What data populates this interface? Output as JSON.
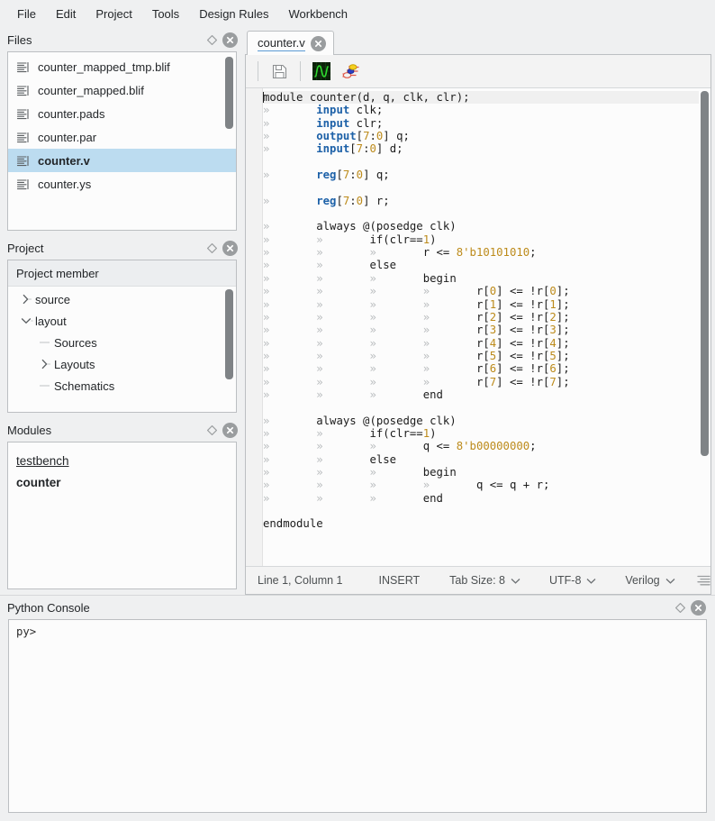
{
  "menubar": {
    "items": [
      {
        "label": "File"
      },
      {
        "label": "Edit"
      },
      {
        "label": "Project"
      },
      {
        "label": "Tools"
      },
      {
        "label": "Design Rules"
      },
      {
        "label": "Workbench"
      }
    ]
  },
  "files_panel": {
    "title": "Files",
    "float_icon": "diamond-icon",
    "close_icon": "close-icon",
    "items": [
      {
        "label": "counter_mapped_tmp.blif",
        "icon": "document-icon",
        "selected": false
      },
      {
        "label": "counter_mapped.blif",
        "icon": "document-icon",
        "selected": false
      },
      {
        "label": "counter.pads",
        "icon": "document-icon",
        "selected": false
      },
      {
        "label": "counter.par",
        "icon": "document-icon",
        "selected": false
      },
      {
        "label": "counter.v",
        "icon": "document-icon",
        "selected": true
      },
      {
        "label": "counter.ys",
        "icon": "document-icon",
        "selected": false
      }
    ]
  },
  "project_panel": {
    "title": "Project",
    "column_header": "Project member",
    "items": [
      {
        "label": "source",
        "depth": 0,
        "state": "collapsed"
      },
      {
        "label": "layout",
        "depth": 0,
        "state": "expanded"
      },
      {
        "label": "Sources",
        "depth": 1,
        "state": "leaf"
      },
      {
        "label": "Layouts",
        "depth": 1,
        "state": "collapsed"
      },
      {
        "label": "Schematics",
        "depth": 1,
        "state": "leaf"
      }
    ]
  },
  "modules_panel": {
    "title": "Modules",
    "items": [
      {
        "label": "testbench",
        "style": "underline"
      },
      {
        "label": "counter",
        "style": "bold"
      }
    ]
  },
  "editor": {
    "tab": {
      "label": "counter.v",
      "close_icon": "close-icon"
    },
    "toolbar": [
      {
        "name": "save-button",
        "icon": "floppy-disk-icon"
      },
      {
        "name": "waveform-button",
        "icon": "waveform-icon"
      },
      {
        "name": "schematic-button",
        "icon": "logic-gate-icon"
      }
    ],
    "code_lines": [
      {
        "fold": "open",
        "current": true,
        "caret": true,
        "tabs": 0,
        "tokens": [
          {
            "t": "module counter(d, q, clk, clr);",
            "c": "plain"
          }
        ]
      },
      {
        "tabs": 1,
        "tokens": [
          {
            "t": "input",
            "c": "kw"
          },
          {
            "t": " clk;",
            "c": "plain"
          }
        ]
      },
      {
        "tabs": 1,
        "tokens": [
          {
            "t": "input",
            "c": "kw"
          },
          {
            "t": " clr;",
            "c": "plain"
          }
        ]
      },
      {
        "tabs": 1,
        "tokens": [
          {
            "t": "output",
            "c": "kw"
          },
          {
            "t": "[",
            "c": "plain"
          },
          {
            "t": "7",
            "c": "num"
          },
          {
            "t": ":",
            "c": "plain"
          },
          {
            "t": "0",
            "c": "num"
          },
          {
            "t": "] q;",
            "c": "plain"
          }
        ]
      },
      {
        "tabs": 1,
        "tokens": [
          {
            "t": "input",
            "c": "kw"
          },
          {
            "t": "[",
            "c": "plain"
          },
          {
            "t": "7",
            "c": "num"
          },
          {
            "t": ":",
            "c": "plain"
          },
          {
            "t": "0",
            "c": "num"
          },
          {
            "t": "] d;",
            "c": "plain"
          }
        ]
      },
      {
        "tabs": 0,
        "tokens": []
      },
      {
        "tabs": 1,
        "tokens": [
          {
            "t": "reg",
            "c": "kw"
          },
          {
            "t": "[",
            "c": "plain"
          },
          {
            "t": "7",
            "c": "num"
          },
          {
            "t": ":",
            "c": "plain"
          },
          {
            "t": "0",
            "c": "num"
          },
          {
            "t": "] q;",
            "c": "plain"
          }
        ]
      },
      {
        "tabs": 0,
        "tokens": []
      },
      {
        "tabs": 1,
        "tokens": [
          {
            "t": "reg",
            "c": "kw"
          },
          {
            "t": "[",
            "c": "plain"
          },
          {
            "t": "7",
            "c": "num"
          },
          {
            "t": ":",
            "c": "plain"
          },
          {
            "t": "0",
            "c": "num"
          },
          {
            "t": "] r;",
            "c": "plain"
          }
        ]
      },
      {
        "tabs": 0,
        "tokens": []
      },
      {
        "tabs": 1,
        "tokens": [
          {
            "t": "always @(posedge clk)",
            "c": "plain"
          }
        ]
      },
      {
        "tabs": 2,
        "tokens": [
          {
            "t": "if(clr==",
            "c": "plain"
          },
          {
            "t": "1",
            "c": "num"
          },
          {
            "t": ")",
            "c": "plain"
          }
        ]
      },
      {
        "tabs": 3,
        "tokens": [
          {
            "t": "r <= ",
            "c": "plain"
          },
          {
            "t": "8'b10101010",
            "c": "num"
          },
          {
            "t": ";",
            "c": "plain"
          }
        ]
      },
      {
        "tabs": 2,
        "tokens": [
          {
            "t": "else",
            "c": "plain"
          }
        ]
      },
      {
        "fold": "open",
        "tabs": 3,
        "tokens": [
          {
            "t": "begin",
            "c": "plain"
          }
        ]
      },
      {
        "tabs": 4,
        "tokens": [
          {
            "t": "r[",
            "c": "plain"
          },
          {
            "t": "0",
            "c": "num"
          },
          {
            "t": "] <= !r[",
            "c": "plain"
          },
          {
            "t": "0",
            "c": "num"
          },
          {
            "t": "];",
            "c": "plain"
          }
        ]
      },
      {
        "tabs": 4,
        "tokens": [
          {
            "t": "r[",
            "c": "plain"
          },
          {
            "t": "1",
            "c": "num"
          },
          {
            "t": "] <= !r[",
            "c": "plain"
          },
          {
            "t": "1",
            "c": "num"
          },
          {
            "t": "];",
            "c": "plain"
          }
        ]
      },
      {
        "tabs": 4,
        "tokens": [
          {
            "t": "r[",
            "c": "plain"
          },
          {
            "t": "2",
            "c": "num"
          },
          {
            "t": "] <= !r[",
            "c": "plain"
          },
          {
            "t": "2",
            "c": "num"
          },
          {
            "t": "];",
            "c": "plain"
          }
        ]
      },
      {
        "tabs": 4,
        "tokens": [
          {
            "t": "r[",
            "c": "plain"
          },
          {
            "t": "3",
            "c": "num"
          },
          {
            "t": "] <= !r[",
            "c": "plain"
          },
          {
            "t": "3",
            "c": "num"
          },
          {
            "t": "];",
            "c": "plain"
          }
        ]
      },
      {
        "tabs": 4,
        "tokens": [
          {
            "t": "r[",
            "c": "plain"
          },
          {
            "t": "4",
            "c": "num"
          },
          {
            "t": "] <= !r[",
            "c": "plain"
          },
          {
            "t": "4",
            "c": "num"
          },
          {
            "t": "];",
            "c": "plain"
          }
        ]
      },
      {
        "tabs": 4,
        "tokens": [
          {
            "t": "r[",
            "c": "plain"
          },
          {
            "t": "5",
            "c": "num"
          },
          {
            "t": "] <= !r[",
            "c": "plain"
          },
          {
            "t": "5",
            "c": "num"
          },
          {
            "t": "];",
            "c": "plain"
          }
        ]
      },
      {
        "tabs": 4,
        "tokens": [
          {
            "t": "r[",
            "c": "plain"
          },
          {
            "t": "6",
            "c": "num"
          },
          {
            "t": "] <= !r[",
            "c": "plain"
          },
          {
            "t": "6",
            "c": "num"
          },
          {
            "t": "];",
            "c": "plain"
          }
        ]
      },
      {
        "tabs": 4,
        "tokens": [
          {
            "t": "r[",
            "c": "plain"
          },
          {
            "t": "7",
            "c": "num"
          },
          {
            "t": "] <= !r[",
            "c": "plain"
          },
          {
            "t": "7",
            "c": "num"
          },
          {
            "t": "];",
            "c": "plain"
          }
        ]
      },
      {
        "tabs": 3,
        "tokens": [
          {
            "t": "end",
            "c": "plain"
          }
        ]
      },
      {
        "tabs": 0,
        "tokens": []
      },
      {
        "tabs": 1,
        "tokens": [
          {
            "t": "always @(posedge clk)",
            "c": "plain"
          }
        ]
      },
      {
        "tabs": 2,
        "tokens": [
          {
            "t": "if(clr==",
            "c": "plain"
          },
          {
            "t": "1",
            "c": "num"
          },
          {
            "t": ")",
            "c": "plain"
          }
        ]
      },
      {
        "tabs": 3,
        "tokens": [
          {
            "t": "q <= ",
            "c": "plain"
          },
          {
            "t": "8'b00000000",
            "c": "num"
          },
          {
            "t": ";",
            "c": "plain"
          }
        ]
      },
      {
        "tabs": 2,
        "tokens": [
          {
            "t": "else",
            "c": "plain"
          }
        ]
      },
      {
        "fold": "open",
        "tabs": 3,
        "tokens": [
          {
            "t": "begin",
            "c": "plain"
          }
        ]
      },
      {
        "tabs": 4,
        "tokens": [
          {
            "t": "q <= q + r;",
            "c": "plain"
          }
        ]
      },
      {
        "tabs": 3,
        "tokens": [
          {
            "t": "end",
            "c": "plain"
          }
        ]
      },
      {
        "tabs": 0,
        "tokens": []
      },
      {
        "tabs": 0,
        "tokens": [
          {
            "t": "endmodule",
            "c": "plain"
          }
        ]
      }
    ],
    "statusbar": {
      "position": "Line 1, Column 1",
      "mode": "INSERT",
      "tab_size": "Tab Size: 8",
      "encoding": "UTF-8",
      "language": "Verilog",
      "chevron_icon": "chevron-down-icon",
      "indent_icon": "indent-icon"
    }
  },
  "console_panel": {
    "title": "Python Console",
    "prompt": "py>"
  },
  "colors": {
    "selection": "#bcdcf0",
    "keyword": "#1d61a8",
    "number": "#bd8b1b",
    "fold_marker": "#4a90c4",
    "panel_bg": "#eff0f1",
    "content_bg": "#fcfcfc"
  }
}
